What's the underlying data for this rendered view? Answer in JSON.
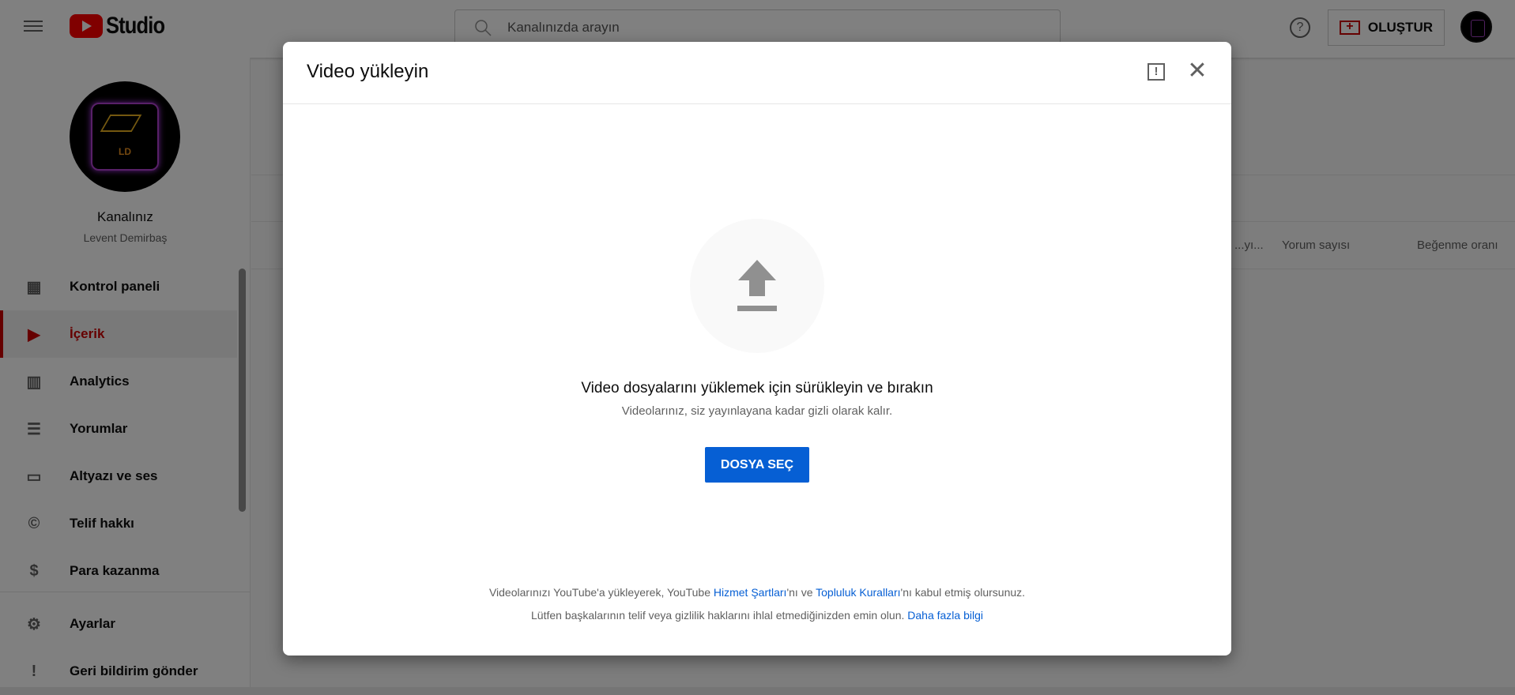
{
  "header": {
    "logo_text": "Studio",
    "search_placeholder": "Kanalınızda arayın",
    "create_label": "OLUŞTUR"
  },
  "channel": {
    "title": "Kanalınız",
    "name": "Levent Demirbaş",
    "avatar_text": "LD"
  },
  "sidebar": {
    "items": [
      {
        "label": "Kontrol paneli",
        "icon": "dashboard-icon"
      },
      {
        "label": "İçerik",
        "icon": "content-icon",
        "active": true
      },
      {
        "label": "Analytics",
        "icon": "analytics-icon"
      },
      {
        "label": "Yorumlar",
        "icon": "comments-icon"
      },
      {
        "label": "Altyazı ve ses",
        "icon": "subtitles-icon"
      },
      {
        "label": "Telif hakkı",
        "icon": "copyright-icon"
      },
      {
        "label": "Para kazanma",
        "icon": "dollar-icon"
      }
    ],
    "bottom": [
      {
        "label": "Ayarlar",
        "icon": "gear-icon"
      },
      {
        "label": "Geri bildirim gönder",
        "icon": "feedback-icon"
      }
    ]
  },
  "main": {
    "columns": [
      "...yı...",
      "Yorum sayısı",
      "Beğenme oranı"
    ]
  },
  "modal": {
    "title": "Video yükleyin",
    "drop_text": "Video dosyalarını yüklemek için sürükleyin ve bırakın",
    "privacy_text": "Videolarınız, siz yayınlayana kadar gizli olarak kalır.",
    "select_button": "DOSYA SEÇ",
    "footer": {
      "line1_a": "Videolarınızı YouTube'a yükleyerek, YouTube ",
      "link_terms": "Hizmet Şartları",
      "line1_b": "'nı ve ",
      "link_guidelines": "Topluluk Kuralları",
      "line1_c": "'nı kabul etmiş olursunuz.",
      "line2": "Lütfen başkalarının telif veya gizlilik haklarını ihlal etmediğinizden emin olun. ",
      "link_more": "Daha fazla bilgi"
    }
  },
  "colors": {
    "accent": "#065fd4",
    "brand": "#ff0000",
    "active": "#cc0000"
  }
}
